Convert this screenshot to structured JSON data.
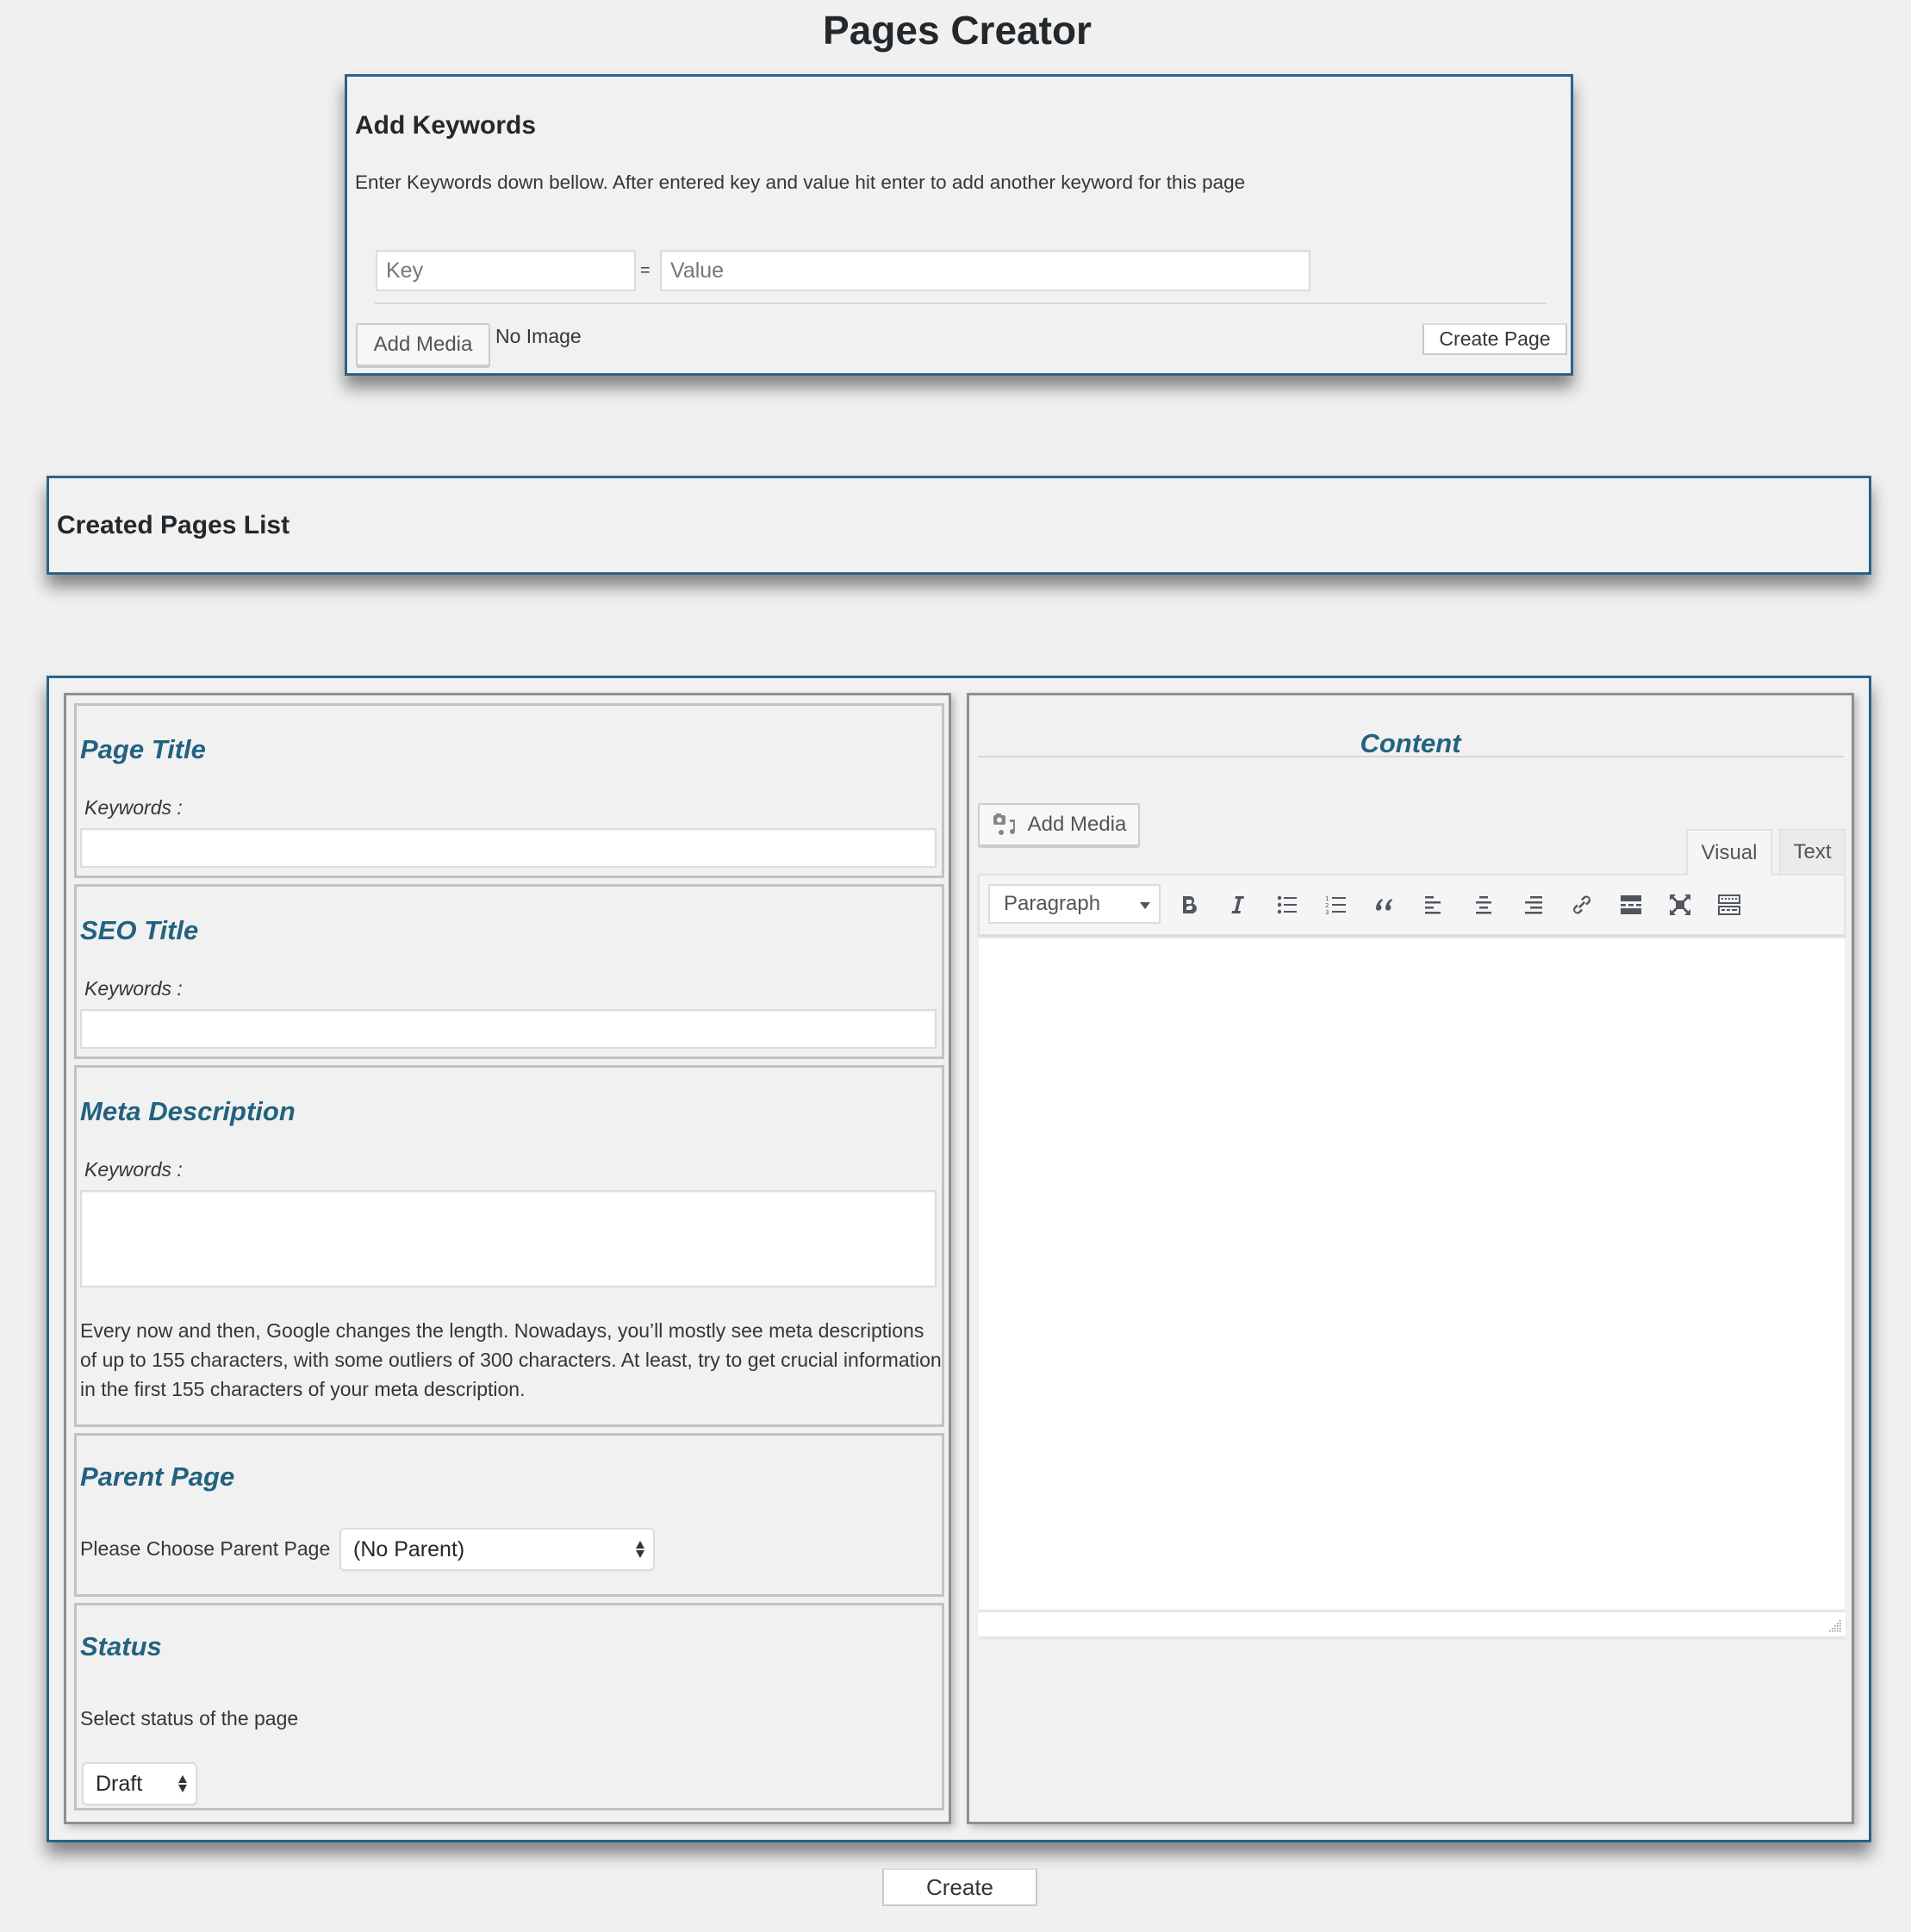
{
  "page": {
    "title": "Pages Creator"
  },
  "add_keywords": {
    "title": "Add Keywords",
    "description": "Enter Keywords down bellow. After entered key and value hit enter to add another keyword for this page",
    "key_placeholder": "Key",
    "key_value": "",
    "separator": "=",
    "value_placeholder": "Value",
    "value_value": "",
    "add_media_label": "Add Media",
    "no_image_text": "No Image",
    "create_page_label": "Create Page"
  },
  "created_pages_list": {
    "title": "Created Pages List"
  },
  "form": {
    "page_title": {
      "title": "Page Title",
      "keywords_label": "Keywords :",
      "value": ""
    },
    "seo_title": {
      "title": "SEO Title",
      "keywords_label": "Keywords :",
      "value": ""
    },
    "meta_description": {
      "title": "Meta Description",
      "keywords_label": "Keywords :",
      "value": "",
      "help_text": "Every now and then, Google changes the length. Nowadays, you’ll mostly see meta descriptions of up to 155 characters, with some outliers of 300 characters. At least, try to get crucial information in the first 155 characters of your meta description."
    },
    "parent_page": {
      "title": "Parent Page",
      "label": "Please Choose Parent Page",
      "selected": "(No Parent)"
    },
    "status": {
      "title": "Status",
      "label": "Select status of the page",
      "selected": "Draft"
    }
  },
  "content_editor": {
    "title": "Content",
    "add_media_label": "Add Media",
    "tabs": [
      {
        "label": "Visual",
        "active": true
      },
      {
        "label": "Text",
        "active": false
      }
    ],
    "format_selected": "Paragraph",
    "toolbar_icons": [
      "bold-icon",
      "italic-icon",
      "bulleted-list-icon",
      "numbered-list-icon",
      "blockquote-icon",
      "align-left-icon",
      "align-center-icon",
      "align-right-icon",
      "link-icon",
      "read-more-icon",
      "fullscreen-icon",
      "toolbar-toggle-icon"
    ],
    "body": ""
  },
  "footer": {
    "create_label": "Create"
  },
  "colors": {
    "accent": "#2a6387",
    "section_title": "#23627f",
    "background": "#f0f0f0"
  }
}
